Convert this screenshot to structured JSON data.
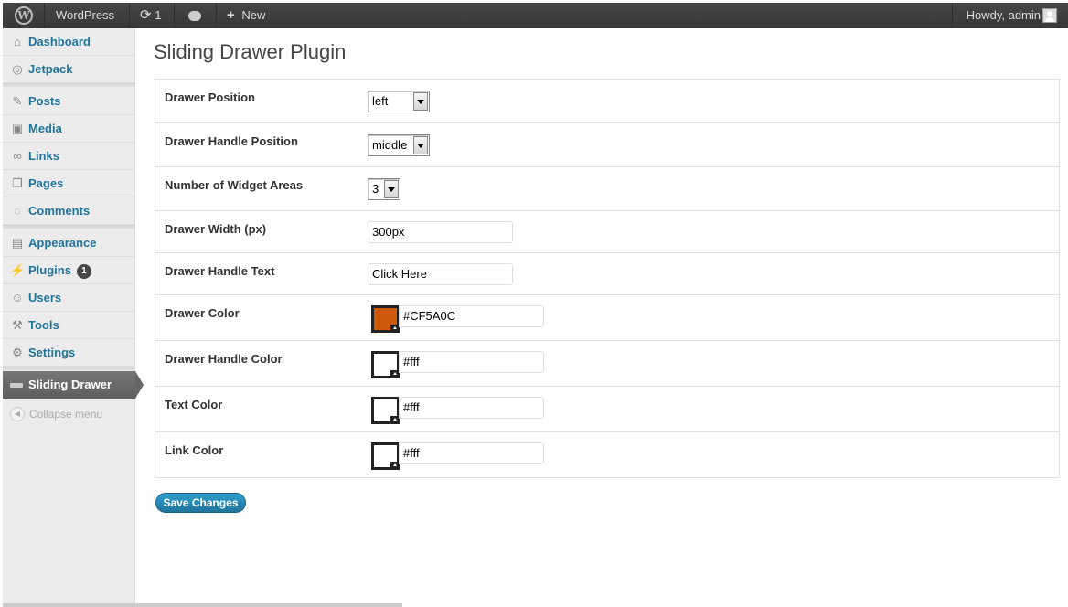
{
  "admin_bar": {
    "site_name": "WordPress",
    "updates_count": "1",
    "new_label": "New",
    "howdy": "Howdy, admin"
  },
  "sidebar": {
    "items": [
      {
        "label": "Dashboard",
        "icon": "home-icon"
      },
      {
        "label": "Jetpack",
        "icon": "jetpack-icon"
      },
      {
        "label": "Posts",
        "icon": "pushpin-icon"
      },
      {
        "label": "Media",
        "icon": "media-icon"
      },
      {
        "label": "Links",
        "icon": "link-icon"
      },
      {
        "label": "Pages",
        "icon": "pages-icon"
      },
      {
        "label": "Comments",
        "icon": "speech-bubble-icon"
      },
      {
        "label": "Appearance",
        "icon": "appearance-icon"
      },
      {
        "label": "Plugins",
        "icon": "plug-icon",
        "badge": "1"
      },
      {
        "label": "Users",
        "icon": "users-icon"
      },
      {
        "label": "Tools",
        "icon": "tools-icon"
      },
      {
        "label": "Settings",
        "icon": "settings-icon"
      }
    ],
    "current": "Sliding Drawer",
    "collapse_label": "Collapse menu"
  },
  "page": {
    "title": "Sliding Drawer Plugin"
  },
  "settings": {
    "drawer_position": {
      "label": "Drawer Position",
      "value": "left"
    },
    "handle_position": {
      "label": "Drawer Handle Position",
      "value": "middle"
    },
    "widget_areas": {
      "label": "Number of Widget Areas",
      "value": "3"
    },
    "drawer_width": {
      "label": "Drawer Width (px)",
      "value": "300px"
    },
    "handle_text": {
      "label": "Drawer Handle Text",
      "value": "Click Here"
    },
    "drawer_color": {
      "label": "Drawer Color",
      "value": "#CF5A0C",
      "swatch": "#CF5A0C"
    },
    "handle_color": {
      "label": "Drawer Handle Color",
      "value": "#fff",
      "swatch": "#ffffff"
    },
    "text_color": {
      "label": "Text Color",
      "value": "#fff",
      "swatch": "#ffffff"
    },
    "link_color": {
      "label": "Link Color",
      "value": "#fff",
      "swatch": "#ffffff"
    }
  },
  "save_label": "Save Changes",
  "colors": {
    "admin_bar": "#464646",
    "link_blue": "#21759b",
    "button_blue": "#2e9fd2"
  }
}
